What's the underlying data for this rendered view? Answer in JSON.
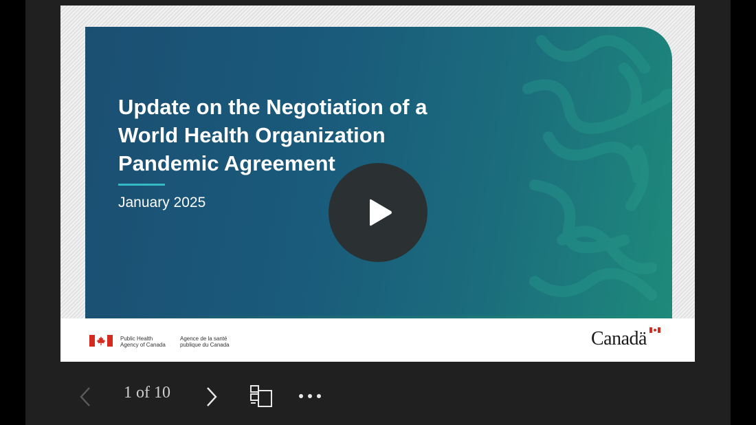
{
  "slide": {
    "title_lines": [
      "Update on the Negotiation of a",
      "World Health Organization",
      "Pandemic Agreement"
    ],
    "date": "January 2025",
    "footer": {
      "agency_en": [
        "Public Health",
        "Agency of Canada"
      ],
      "agency_fr": [
        "Agence de la santé",
        "publique du Canada"
      ],
      "wordmark": "Canadä"
    }
  },
  "player": {
    "play_icon": "play-icon"
  },
  "toolbar": {
    "page_indicator": "1 of 10",
    "prev_icon": "chevron-left-icon",
    "next_icon": "chevron-right-icon",
    "thumbnails_icon": "thumbnails-icon",
    "more_icon": "more-horizontal-icon"
  },
  "colors": {
    "slide_gradient_start": "#1b4f72",
    "slide_gradient_end": "#1e8a7b",
    "accent_rule": "#35b9c4",
    "flag_red": "#d52b1e",
    "toolbar_bg": "#202020"
  }
}
